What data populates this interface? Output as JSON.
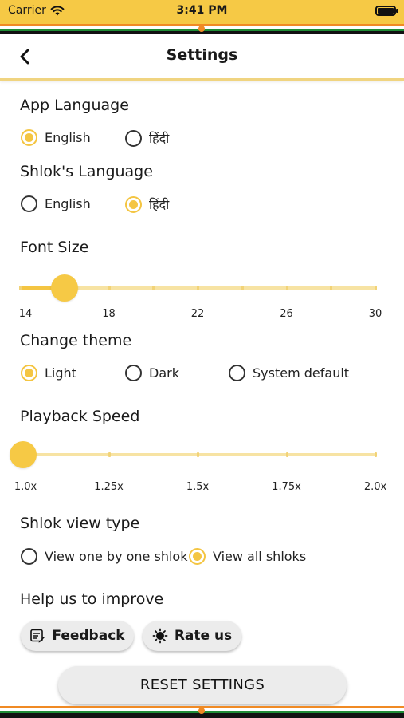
{
  "status_bar": {
    "carrier": "Carrier",
    "time": "3:41 PM"
  },
  "nav": {
    "title": "Settings"
  },
  "app_language": {
    "title": "App Language",
    "options": [
      {
        "label": "English",
        "selected": true
      },
      {
        "label": "हिंदी",
        "selected": false
      }
    ]
  },
  "shlok_language": {
    "title": "Shlok's Language",
    "options": [
      {
        "label": "English",
        "selected": false
      },
      {
        "label": "हिंदी",
        "selected": true
      }
    ]
  },
  "font_size": {
    "title": "Font Size",
    "value": 16,
    "min": 14,
    "max": 30,
    "labels": [
      "14",
      "18",
      "22",
      "26",
      "30"
    ]
  },
  "theme": {
    "title": "Change theme",
    "options": [
      {
        "label": "Light",
        "selected": true
      },
      {
        "label": "Dark",
        "selected": false
      },
      {
        "label": "System default",
        "selected": false
      }
    ]
  },
  "playback_speed": {
    "title": "Playback Speed",
    "value": 1.0,
    "min": 1.0,
    "max": 2.0,
    "labels": [
      "1.0x",
      "1.25x",
      "1.5x",
      "1.75x",
      "2.0x"
    ]
  },
  "view_type": {
    "title": "Shlok view type",
    "options": [
      {
        "label": "View one by one shlok",
        "selected": false
      },
      {
        "label": "View all shloks",
        "selected": true
      }
    ]
  },
  "help": {
    "title": "Help us to improve",
    "feedback_label": "Feedback",
    "rate_label": "Rate us"
  },
  "reset_label": "RESET SETTINGS",
  "colors": {
    "accent": "#f6c945",
    "track": "#f7e3a3",
    "saffron": "#f08a24",
    "green": "#1f8c36"
  }
}
